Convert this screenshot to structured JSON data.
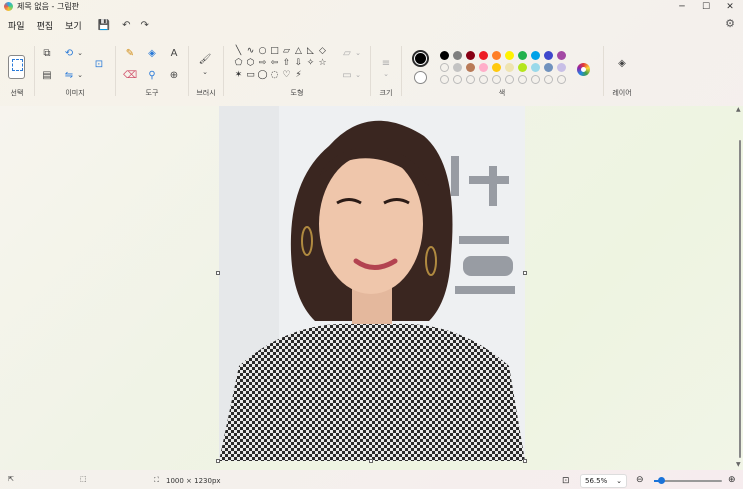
{
  "window": {
    "title": "제목 없음 - 그림판",
    "minimize": "─",
    "maximize": "☐",
    "close": "✕"
  },
  "menu": {
    "items": [
      "파일",
      "편집",
      "보기"
    ],
    "save": "💾",
    "undo": "↶",
    "redo": "↷",
    "settings": "⚙"
  },
  "ribbon": {
    "groups": {
      "select": "선택",
      "image": "이미지",
      "tools": "도구",
      "brush": "브러시",
      "shapes": "도형",
      "size": "크기",
      "colors": "색",
      "layers": "레이어"
    },
    "icons": {
      "crop": "⧉",
      "resize": "▤",
      "rotate": "⟲",
      "flip": "⇋",
      "image_select": "⊡",
      "pencil": "✎",
      "fill": "◈",
      "text": "A",
      "eraser": "⌫",
      "picker": "⚲",
      "magnifier": "⊕",
      "brush": "🖌",
      "outline": "▱",
      "fill_shape": "▭",
      "size_lines": "≡",
      "layers": "◈",
      "chev": "⌄"
    },
    "shapes": [
      "╲",
      "∿",
      "○",
      "□",
      "▱",
      "△",
      "◺",
      "◇",
      "⬠",
      "⬡",
      "⇨",
      "⇦",
      "⇧",
      "⇩",
      "✧",
      "☆",
      "✶",
      "▭",
      "◯",
      "◌",
      "♡",
      "⚡"
    ],
    "palette_row1": [
      "#000000",
      "#7f7f7f",
      "#880015",
      "#ed1c24",
      "#ff7f27",
      "#fff200",
      "#22b14c",
      "#00a2e8",
      "#3f48cc",
      "#a349a4"
    ],
    "palette_row2": [
      "",
      "#c3c3c3",
      "#b97a57",
      "#ffaec9",
      "#ffc90e",
      "#efe4b0",
      "#b5e61d",
      "#99d9ea",
      "#7092be",
      "#c8bfe7"
    ],
    "palette_row3": [
      "",
      "",
      "",
      "",
      "",
      "",
      "",
      "",
      "",
      ""
    ]
  },
  "status": {
    "pointer_icon": "⇱",
    "selection_icon": "⬚",
    "canvas_icon": "⛶",
    "canvas_size": "1000 × 1230px",
    "fit_icon": "⊡",
    "zoom": "56.5%",
    "zoom_out": "⊖",
    "zoom_in": "⊕",
    "zoom_fraction": 0.1
  }
}
